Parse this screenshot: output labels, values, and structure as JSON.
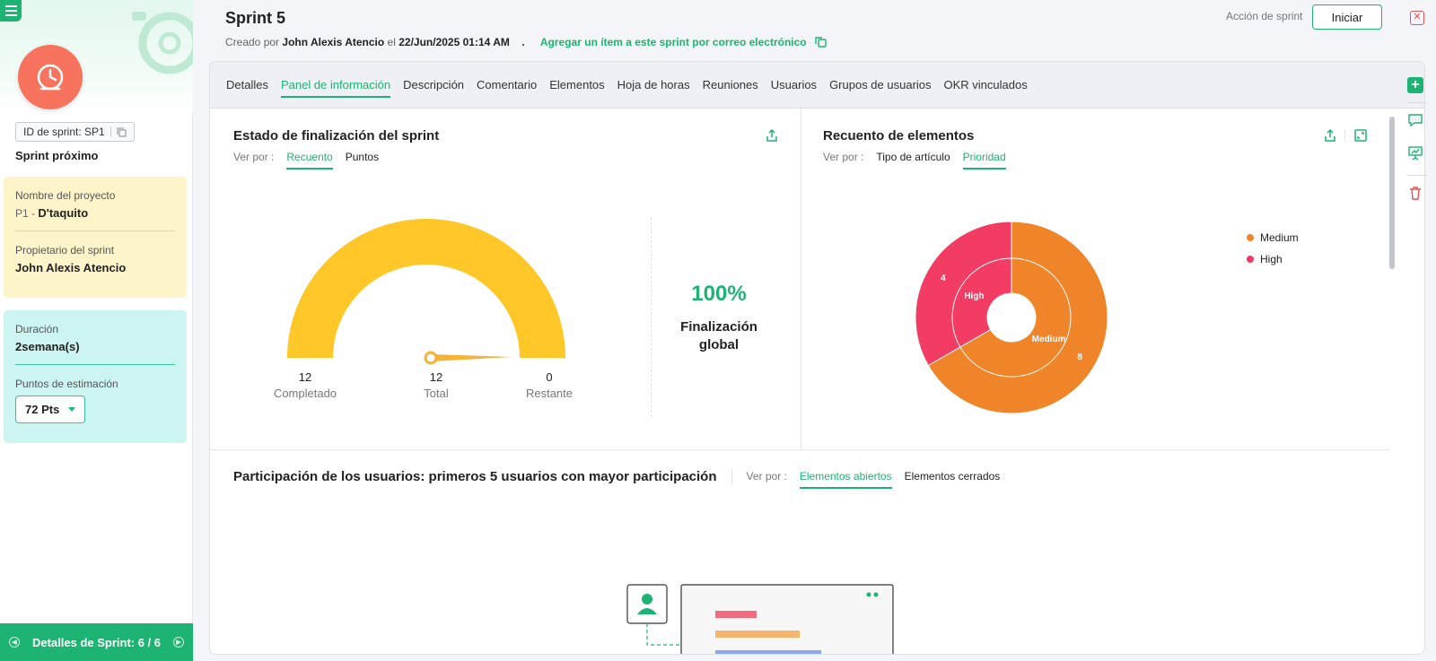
{
  "sidebar": {
    "sprint_id": "ID de sprint: SP1",
    "status": "Sprint próximo",
    "project_label": "Nombre del proyecto",
    "project_prefix": "P1 - ",
    "project_name": "D'taquito",
    "owner_label": "Propietario del sprint",
    "owner_name": "John Alexis Atencio",
    "duration_label": "Duración",
    "duration_value": "2semana(s)",
    "points_label": "Puntos de estimación",
    "points_value": "72 Pts",
    "footer": "Detalles de Sprint: 6 / 6"
  },
  "header": {
    "title": "Sprint 5",
    "created_by_label": "Creado por",
    "created_by": "John Alexis Atencio",
    "created_on_label": "el",
    "created_on": "22/Jun/2025 01:14 AM",
    "dot": ".",
    "email_link": "Agregar un ítem a este sprint por correo electrónico",
    "sprint_action_label": "Acción de sprint",
    "start_button": "Iniciar"
  },
  "tabs": [
    {
      "label": "Detalles",
      "active": false
    },
    {
      "label": "Panel de información",
      "active": true
    },
    {
      "label": "Descripción",
      "active": false
    },
    {
      "label": "Comentario",
      "active": false
    },
    {
      "label": "Elementos",
      "active": false
    },
    {
      "label": "Hoja de horas",
      "active": false
    },
    {
      "label": "Reuniones",
      "active": false
    },
    {
      "label": "Usuarios",
      "active": false
    },
    {
      "label": "Grupos de usuarios",
      "active": false
    },
    {
      "label": "OKR vinculados",
      "active": false
    }
  ],
  "completion": {
    "title": "Estado de finalización del sprint",
    "view_by_label": "Ver por :",
    "view_options": [
      "Recuento",
      "Puntos"
    ],
    "completed_value": "12",
    "completed_label": "Completado",
    "total_value": "12",
    "total_label": "Total",
    "remaining_value": "0",
    "remaining_label": "Restante",
    "percent": "100%",
    "percent_label_1": "Finalización",
    "percent_label_2": "global",
    "gauge_color": "#ffc727"
  },
  "items_count": {
    "title": "Recuento de elementos",
    "view_by_label": "Ver por :",
    "view_options": [
      "Tipo de artículo",
      "Prioridad"
    ]
  },
  "chart_data": {
    "type": "pie",
    "title": "Recuento de elementos",
    "categories": [
      "Medium",
      "High"
    ],
    "values": [
      8,
      4
    ],
    "colors": [
      "#f08428",
      "#f23c63"
    ],
    "legend": "top-right"
  },
  "participation": {
    "title": "Participación de los usuarios: primeros 5 usuarios con mayor participación",
    "view_by_label": "Ver por :",
    "view_options": [
      "Elementos abiertos",
      "Elementos cerrados"
    ]
  },
  "colors": {
    "accent": "#1db473",
    "medium": "#f08428",
    "high": "#f23c63"
  }
}
